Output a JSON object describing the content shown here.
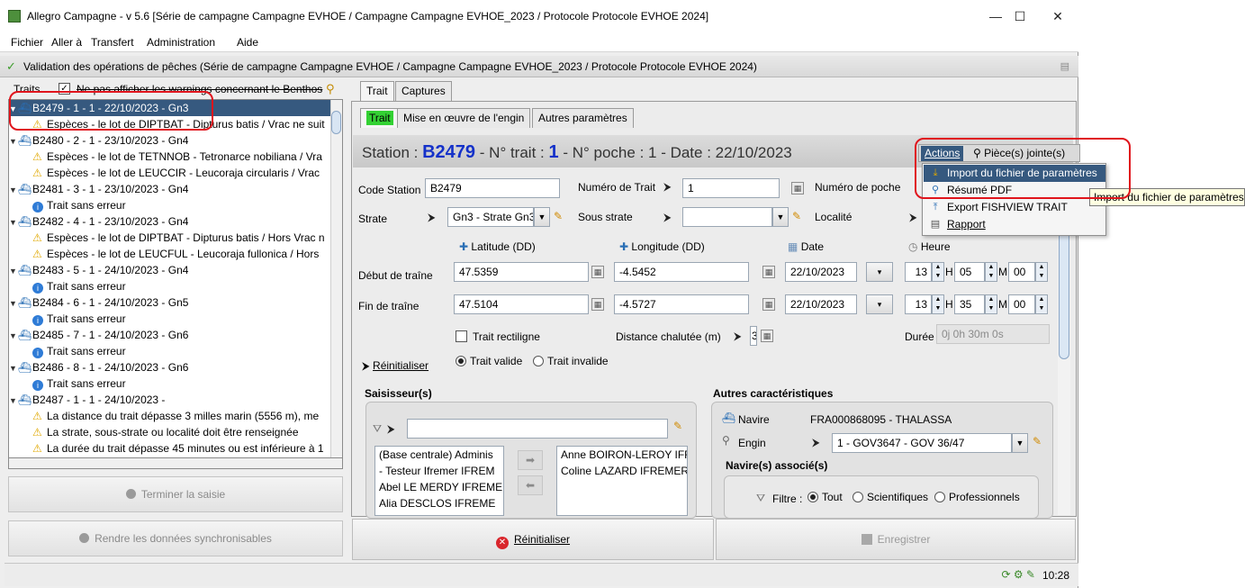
{
  "window": {
    "title": "Allegro Campagne - v 5.6 [Série de campagne Campagne EVHOE / Campagne Campagne EVHOE_2023 / Protocole Protocole EVHOE 2024]",
    "minimize": "—",
    "maximize": "☐",
    "close": "✕"
  },
  "menu": {
    "fichier": "Fichier",
    "aller": "Aller à",
    "transfert": "Transfert",
    "administration": "Administration",
    "aide": "Aide"
  },
  "header": {
    "text": "Validation des opérations de pêches (Série de campagne Campagne EVHOE / Campagne Campagne EVHOE_2023 / Protocole Protocole EVHOE 2024)"
  },
  "left": {
    "traits_label": "Traits",
    "benthos_label": "Ne pas afficher les warnings concernant le Benthos",
    "tree": [
      {
        "text": "B2479 - 1 - 1 - 22/10/2023 - Gn3",
        "kind": "trait",
        "selected": true
      },
      {
        "text": "Espèces - le lot de DIPTBAT - Dipturus batis / Vrac ne suit",
        "kind": "warn"
      },
      {
        "text": "B2480 - 2 - 1 - 23/10/2023 - Gn4",
        "kind": "trait"
      },
      {
        "text": "Espèces - le lot de TETNNOB - Tetronarce nobiliana / Vra",
        "kind": "warn"
      },
      {
        "text": "Espèces - le lot de LEUCCIR - Leucoraja circularis / Vrac",
        "kind": "warn"
      },
      {
        "text": "B2481 - 3 - 1 - 23/10/2023 - Gn4",
        "kind": "trait"
      },
      {
        "text": "Trait sans erreur",
        "kind": "info"
      },
      {
        "text": "B2482 - 4 - 1 - 23/10/2023 - Gn4",
        "kind": "trait"
      },
      {
        "text": "Espèces - le lot de DIPTBAT - Dipturus batis / Hors Vrac n",
        "kind": "warn"
      },
      {
        "text": "Espèces - le lot de LEUCFUL - Leucoraja fullonica / Hors",
        "kind": "warn"
      },
      {
        "text": "B2483 - 5 - 1 - 24/10/2023 - Gn4",
        "kind": "trait"
      },
      {
        "text": "Trait sans erreur",
        "kind": "info"
      },
      {
        "text": "B2484 - 6 - 1 - 24/10/2023 - Gn5",
        "kind": "trait"
      },
      {
        "text": "Trait sans erreur",
        "kind": "info"
      },
      {
        "text": "B2485 - 7 - 1 - 24/10/2023 - Gn6",
        "kind": "trait"
      },
      {
        "text": "Trait sans erreur",
        "kind": "info"
      },
      {
        "text": "B2486 - 8 - 1 - 24/10/2023 - Gn6",
        "kind": "trait"
      },
      {
        "text": "Trait sans erreur",
        "kind": "info"
      },
      {
        "text": "B2487 - 1 - 1 - 24/10/2023 -",
        "kind": "trait"
      },
      {
        "text": "La distance du trait dépasse 3 milles marin (5556 m), me",
        "kind": "warn"
      },
      {
        "text": "La strate, sous-strate ou localité doit être renseignée",
        "kind": "warn"
      },
      {
        "text": "La durée du trait dépasse 45 minutes ou est inférieure à 1",
        "kind": "warn"
      }
    ],
    "btn_terminer": "Terminer la saisie",
    "btn_rendre": "Rendre les données synchronisables"
  },
  "tabs": {
    "trait": "Trait",
    "captures": "Captures",
    "sub_trait": "Trait",
    "sub_mise": "Mise en œuvre de l'engin",
    "sub_autres": "Autres paramètres"
  },
  "station": {
    "prefix": "Station :",
    "code": "B2479",
    "trait_label": "- N° trait :",
    "trait_num": "1",
    "rest": "- N° poche : 1 - Date : 22/10/2023"
  },
  "actions": {
    "label": "Actions",
    "pieces": "Pièce(s) jointe(s)",
    "items": [
      {
        "label": "Import du fichier de paramètres",
        "icon": "import-icon"
      },
      {
        "label": "Résumé PDF",
        "icon": "pdf-icon"
      },
      {
        "label": "Export FISHVIEW TRAIT",
        "icon": "export-icon"
      },
      {
        "label": "Rapport",
        "icon": "report-icon"
      }
    ],
    "tooltip": "Import du fichier de paramètres"
  },
  "form": {
    "code_station_label": "Code Station",
    "code_station_value": "B2479",
    "numero_trait_label": "Numéro de Trait",
    "numero_trait_value": "1",
    "numero_poche_label": "Numéro de poche",
    "strate_label": "Strate",
    "strate_value": "Gn3 - Strate Gn3",
    "sous_strate_label": "Sous strate",
    "sous_strate_value": "",
    "localite_label": "Localité",
    "lat_header": "Latitude (DD)",
    "lon_header": "Longitude (DD)",
    "date_header": "Date",
    "heure_header": "Heure",
    "debut_label": "Début de traîne",
    "debut_lat": "47.5359",
    "debut_lon": "-4.5452",
    "debut_date": "22/10/2023",
    "debut_h": "13",
    "debut_m": "05",
    "debut_s": "00",
    "fin_label": "Fin de traîne",
    "fin_lat": "47.5104",
    "fin_lon": "-4.5727",
    "fin_date": "22/10/2023",
    "fin_h": "13",
    "fin_m": "35",
    "fin_s": "00",
    "h_unit": "H",
    "m_unit": "M",
    "trait_rectiligne": "Trait rectiligne",
    "distance_label": "Distance chalutée (m)",
    "distance_value": "3",
    "duree_label": "Durée",
    "duree_value": "0j 0h 30m 0s",
    "reinit_label": "Réinitialiser",
    "trait_valide": "Trait valide",
    "trait_invalide": "Trait invalide",
    "saisisseur_title": "Saisisseur(s)",
    "saisisseur_left": [
      "(Base centrale) Adminis",
      "- Testeur Ifremer IFREM",
      "Abel LE MERDY IFREME",
      "Alia DESCLOS IFREME"
    ],
    "saisisseur_right": [
      "Anne BOIRON-LEROY IFR",
      "Coline LAZARD IFREMER"
    ],
    "autres_title": "Autres caractéristiques",
    "navire_label": "Navire",
    "navire_value": "FRA000868095 - THALASSA",
    "engin_label": "Engin",
    "engin_value": "1 - GOV3647 - GOV 36/47",
    "navires_associes": "Navire(s) associé(s)",
    "filtre_label": "Filtre :",
    "filtre_tout": "Tout",
    "filtre_scientifiques": "Scientifiques",
    "filtre_professionnels": "Professionnels"
  },
  "bottom": {
    "reinitialiser": "Réinitialiser",
    "enregistrer": "Enregistrer"
  },
  "status": {
    "clock": "10:28"
  },
  "colors": {
    "selection": "#36597f",
    "accent_blue": "#1431c9",
    "highlight_red": "#e0141c",
    "tab_green": "#33d133"
  }
}
